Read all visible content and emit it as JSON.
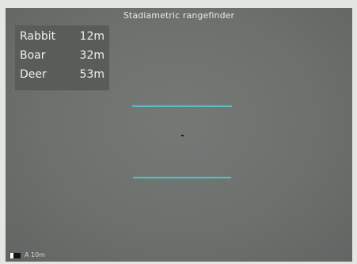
{
  "title": "Stadiametric rangefinder",
  "ranges": [
    {
      "animal": "Rabbit",
      "distance": "12m"
    },
    {
      "animal": "Boar",
      "distance": "32m"
    },
    {
      "animal": "Deer",
      "distance": "53m"
    }
  ],
  "scale_label": "A 10m",
  "colors": {
    "background": "#6d716e",
    "panel": "#595d5a",
    "stadia_line": "#5fb9c0",
    "text": "#eef0ee"
  }
}
